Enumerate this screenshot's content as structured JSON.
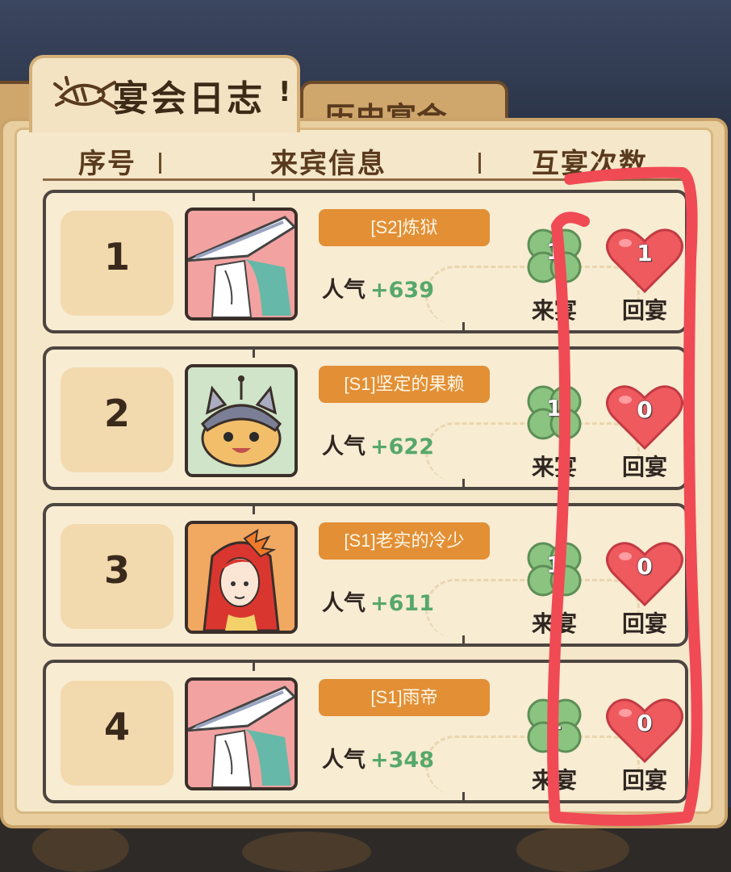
{
  "tabs": {
    "active": "宴会日志",
    "inactive": "历史宴会"
  },
  "header": {
    "col_index": "序号",
    "col_guest": "来宾信息",
    "col_mutual": "互宴次数"
  },
  "popularity_label": "人气",
  "visit_label": "来宴",
  "return_label": "回宴",
  "rows": [
    {
      "index": "1",
      "name": "[S2]炼狱",
      "popularity": "+639",
      "visit": "1",
      "return": "1",
      "avatar": "straw-hat-swordsman"
    },
    {
      "index": "2",
      "name": "[S1]坚定的果赖",
      "popularity": "+622",
      "visit": "1",
      "return": "0",
      "avatar": "helmet-bun"
    },
    {
      "index": "3",
      "name": "[S1]老实的冷少",
      "popularity": "+611",
      "visit": "1",
      "return": "0",
      "avatar": "red-haired-girl"
    },
    {
      "index": "4",
      "name": "[S1]雨帝",
      "popularity": "+348",
      "visit": "1",
      "return": "0",
      "avatar": "straw-hat-swordsman"
    }
  ],
  "colors": {
    "badge": "#e28f35",
    "popularity_value": "#57a86a",
    "annotation": "#f04a55"
  }
}
